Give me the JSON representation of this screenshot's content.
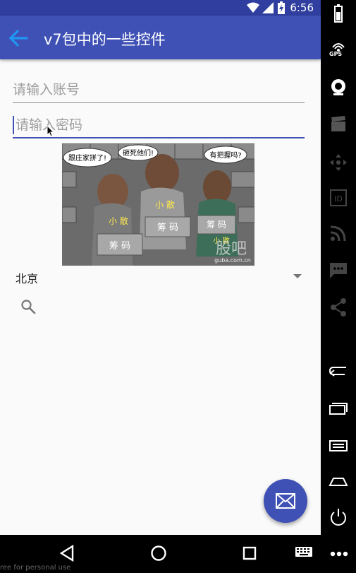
{
  "status_bar": {
    "time": "6:56"
  },
  "app_bar": {
    "title": "v7包中的一些控件",
    "back_icon": "arrow-back-icon"
  },
  "form": {
    "account_placeholder": "请输入账号",
    "password_placeholder": "请输入密码"
  },
  "image": {
    "bubbles": [
      "跟庄家拼了!",
      "砸死他们!",
      "有把握吗?"
    ],
    "labels": [
      "小 散",
      "小 散",
      "筹 码",
      "筹 码",
      "筹 码",
      "小 散"
    ],
    "watermark_big": "股吧",
    "watermark_small": "guba.com.cn"
  },
  "spinner": {
    "selected": "北京"
  },
  "search": {
    "icon": "search-icon"
  },
  "fab": {
    "icon": "mail-icon"
  },
  "side_toolbar": {
    "gps_label": "GPS",
    "id_label": "ID",
    "items": [
      "battery-icon",
      "gps-icon",
      "camera-icon",
      "clapper-icon",
      "dpad-icon",
      "id-icon",
      "rss-icon",
      "message-icon",
      "share-icon",
      "back-icon",
      "recent-icon",
      "menu-icon",
      "home-icon",
      "power-icon"
    ]
  },
  "nav_bar": {
    "items": [
      "back-triangle-icon",
      "home-circle-icon",
      "recents-square-icon",
      "keyboard-icon",
      "more-icon"
    ]
  },
  "footer": {
    "watermark": "ree for personal use"
  },
  "colors": {
    "primary": "#3f51b5",
    "primary_dark": "#303f9f",
    "background": "#fafafa"
  }
}
